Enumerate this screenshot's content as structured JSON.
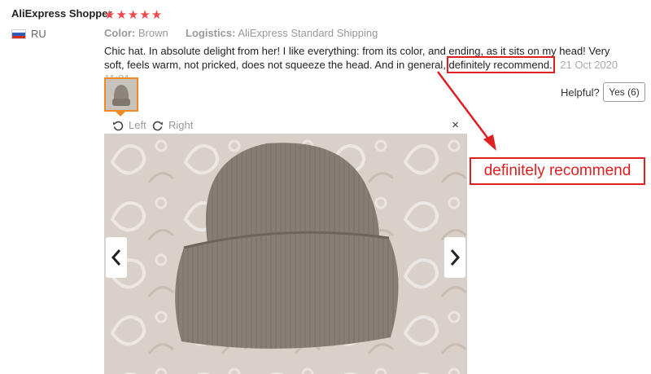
{
  "reviewer": {
    "name": "AliExpress Shopper",
    "stars": "★★★★★",
    "country": "RU"
  },
  "meta": {
    "color_label": "Color:",
    "color_value": "Brown",
    "logistics_label": "Logistics:",
    "logistics_value": "AliExpress Standard Shipping"
  },
  "review": {
    "text_before": "Chic hat. In absolute delight from her! I like everything: from its color, and ending, as it sits on my head! Very soft, feels warm, not pricked, does not squeeze the head. And in general,",
    "text_highlight": "definitely recommend.",
    "date": "21 Oct 2020 11:01"
  },
  "feedback": {
    "helpful_label": "Helpful?",
    "yes_label": "Yes (6)"
  },
  "viewer": {
    "rotate_left": "Left",
    "rotate_right": "Right",
    "close": "×"
  },
  "annotation": {
    "callout": "definitely recommend"
  },
  "colors": {
    "accent": "#f5464a",
    "highlight": "#e02020",
    "thumb_border": "#f08a24"
  },
  "icons": [
    "star-icon",
    "ru-flag-icon",
    "rotate-left-icon",
    "rotate-right-icon",
    "close-icon",
    "chevron-left-icon",
    "chevron-right-icon"
  ]
}
